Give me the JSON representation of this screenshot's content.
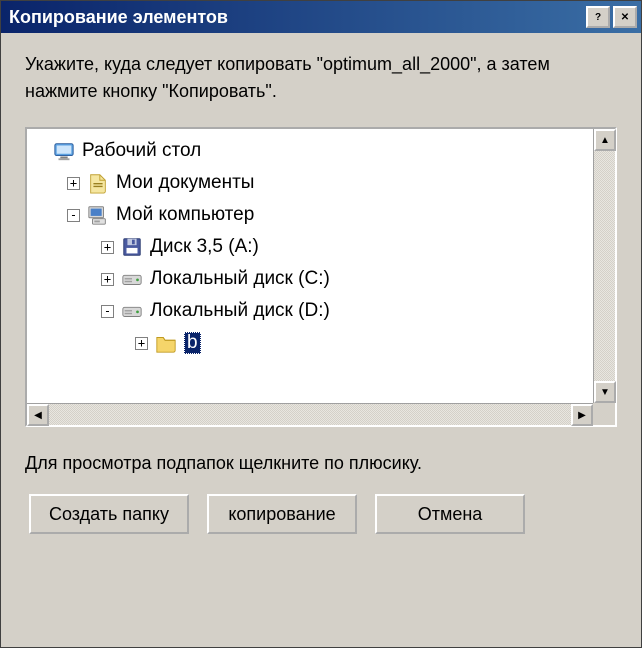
{
  "titlebar": {
    "title": "Копирование элементов",
    "help_tooltip": "?",
    "close_tooltip": "✕"
  },
  "instruction": "Укажите, куда следует копировать \"optimum_all_2000\", а затем нажмите кнопку \"Копировать\".",
  "tree": {
    "items": [
      {
        "indent": 0,
        "expander": "",
        "icon": "desktop",
        "label": "Рабочий стол",
        "selected": false
      },
      {
        "indent": 1,
        "expander": "+",
        "icon": "docs",
        "label": "Мои документы",
        "selected": false
      },
      {
        "indent": 1,
        "expander": "-",
        "icon": "computer",
        "label": "Мой компьютер",
        "selected": false
      },
      {
        "indent": 2,
        "expander": "+",
        "icon": "floppy",
        "label": "Диск 3,5 (A:)",
        "selected": false
      },
      {
        "indent": 2,
        "expander": "+",
        "icon": "hdd",
        "label": "Локальный диск (C:)",
        "selected": false
      },
      {
        "indent": 2,
        "expander": "-",
        "icon": "hdd",
        "label": "Локальный диск (D:)",
        "selected": false
      },
      {
        "indent": 3,
        "expander": "+",
        "icon": "folder",
        "label": "b",
        "selected": true
      }
    ]
  },
  "hint": "Для просмотра подпапок щелкните по плюсику.",
  "buttons": {
    "new_folder": "Создать папку",
    "copy": "копирование",
    "cancel": "Отмена"
  }
}
